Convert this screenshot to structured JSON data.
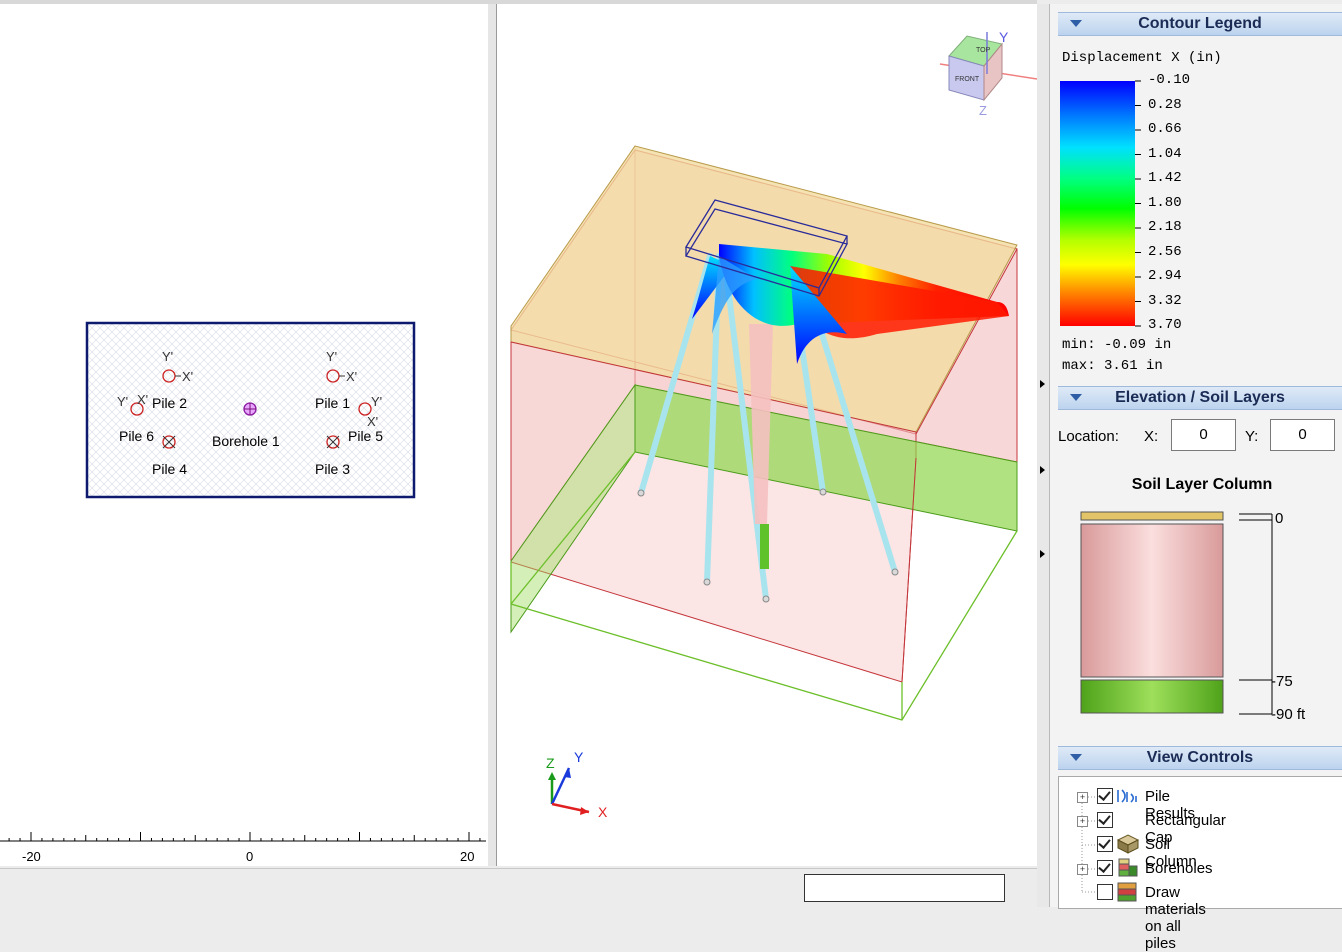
{
  "plan_view": {
    "axis_ticks": [
      "-20",
      "0",
      "20"
    ],
    "pile_labels": [
      {
        "id": "pile-2",
        "text": "Pile 2"
      },
      {
        "id": "pile-1",
        "text": "Pile 1"
      },
      {
        "id": "pile-6",
        "text": "Pile 6"
      },
      {
        "id": "pile-5",
        "text": "Pile 5"
      },
      {
        "id": "pile-4",
        "text": "Pile 4"
      },
      {
        "id": "pile-3",
        "text": "Pile 3"
      }
    ],
    "borehole_label": "Borehole 1",
    "local_axis_x": "X'",
    "local_axis_y": "Y'"
  },
  "view3d": {
    "axis_x": "X",
    "axis_y": "Y",
    "axis_z": "Z",
    "cube_labels": {
      "top": "TOP",
      "front": "FRONT"
    }
  },
  "contour_legend": {
    "title": "Contour Legend",
    "quantity": "Displacement X (in)",
    "levels": [
      "-0.10",
      "0.28",
      "0.66",
      "1.04",
      "1.42",
      "1.80",
      "2.18",
      "2.56",
      "2.94",
      "3.32",
      "3.70"
    ],
    "min_text": "min: -0.09 in",
    "max_text": "max: 3.61 in",
    "colors": [
      "#0000ff",
      "#00b4ff",
      "#00ffc0",
      "#00ff00",
      "#b4ff00",
      "#ffff00",
      "#ffb400",
      "#ff6000",
      "#ff0000"
    ]
  },
  "elevation": {
    "title": "Elevation / Soil Layers",
    "location_label": "Location:",
    "x_label": "X:",
    "x_value": "0",
    "y_label": "Y:",
    "y_value": "0",
    "column_title": "Soil Layer Column",
    "depth_labels": [
      "0",
      "-75",
      "-90 ft"
    ],
    "layer_colors": {
      "cap": "#e4c97a",
      "clay": "#f2c6c6",
      "sand": "#7ccf3a"
    }
  },
  "view_controls": {
    "title": "View Controls",
    "items": [
      {
        "label": "Pile Results",
        "checked": true,
        "expandable": true,
        "icon": "pile-results-icon"
      },
      {
        "label": "Rectangular Cap",
        "checked": true,
        "expandable": true,
        "icon": ""
      },
      {
        "label": "Soil Column",
        "checked": true,
        "expandable": false,
        "icon": "soil-column-icon"
      },
      {
        "label": "Boreholes",
        "checked": true,
        "expandable": true,
        "icon": "boreholes-icon"
      },
      {
        "label": "Draw materials on all piles",
        "checked": false,
        "expandable": false,
        "icon": "materials-icon"
      }
    ]
  },
  "status": {
    "field_value": ""
  }
}
